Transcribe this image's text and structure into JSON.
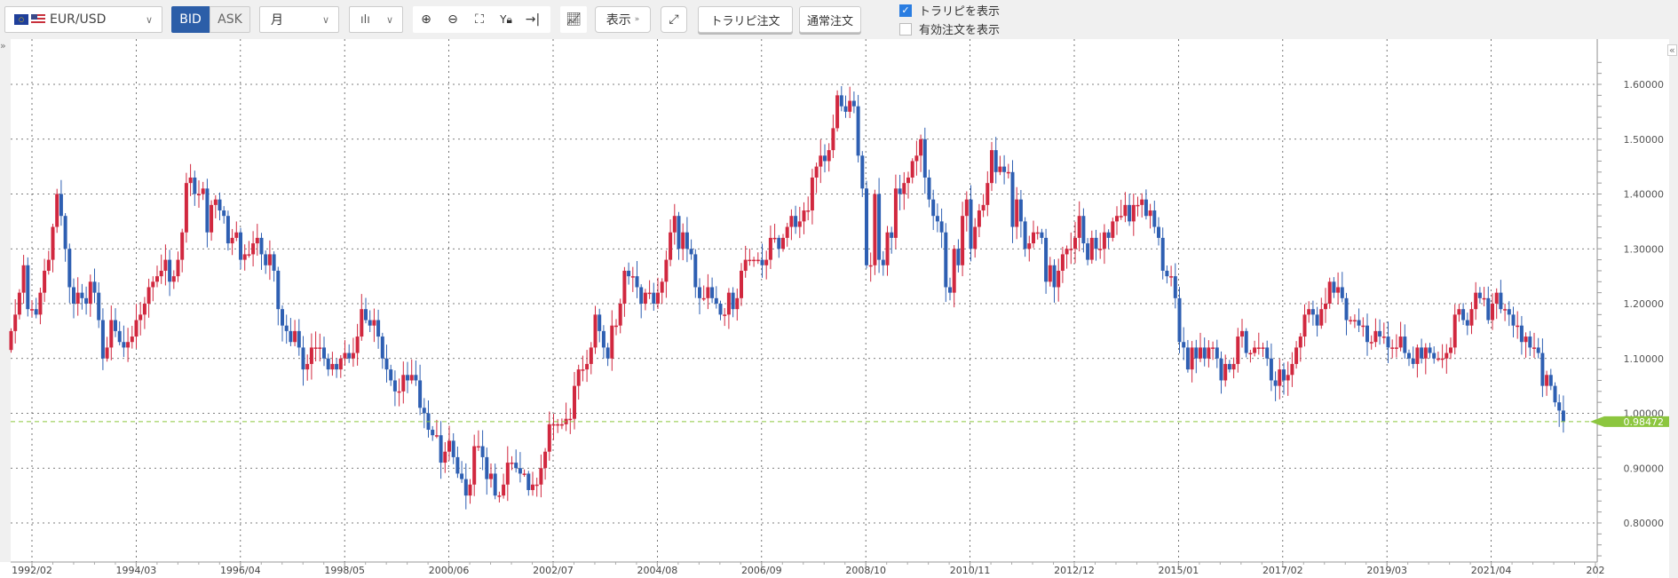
{
  "toolbar": {
    "pair": "EUR/USD",
    "bid": "BID",
    "ask": "ASK",
    "timeframe": "月",
    "display": "表示",
    "trarip_order": "トラリピ注文",
    "normal_order": "通常注文",
    "show_trarip": "トラリピを表示",
    "show_trarip_checked": true,
    "show_active_orders": "有効注文を表示",
    "show_active_orders_checked": false,
    "icons": [
      "zoom-in-icon",
      "zoom-out-icon",
      "fit-icon",
      "y-lock-icon",
      "jump-latest-icon",
      "indicator-icon",
      "expand-icon"
    ]
  },
  "colors": {
    "up": "#d1283f",
    "down": "#2e5fb2",
    "current": "#8cc63f",
    "bid_active": "#2c5ea8"
  },
  "chart_data": {
    "type": "candlestick",
    "start": "1991/09",
    "interval": "month",
    "ylim": [
      0.74,
      1.66
    ],
    "yticks": [
      "0.80000",
      "0.90000",
      "1.00000",
      "1.10000",
      "1.20000",
      "1.30000",
      "1.40000",
      "1.50000",
      "1.60000"
    ],
    "xticks": [
      "1992/02",
      "1994/03",
      "1996/04",
      "1998/05",
      "2000/06",
      "2002/07",
      "2004/08",
      "2006/09",
      "2008/10",
      "2010/11",
      "2012/12",
      "2015/01",
      "2017/02",
      "2019/03",
      "2021/04",
      "202"
    ],
    "current_price": 0.98472,
    "current_label": "0.98472",
    "close": [
      1.15,
      1.18,
      1.22,
      1.27,
      1.19,
      1.19,
      1.18,
      1.22,
      1.26,
      1.28,
      1.34,
      1.4,
      1.36,
      1.3,
      1.23,
      1.2,
      1.22,
      1.21,
      1.2,
      1.24,
      1.22,
      1.17,
      1.1,
      1.12,
      1.17,
      1.15,
      1.13,
      1.12,
      1.13,
      1.14,
      1.17,
      1.18,
      1.2,
      1.23,
      1.24,
      1.25,
      1.26,
      1.28,
      1.24,
      1.25,
      1.28,
      1.33,
      1.42,
      1.43,
      1.4,
      1.4,
      1.41,
      1.33,
      1.38,
      1.39,
      1.37,
      1.36,
      1.31,
      1.32,
      1.33,
      1.28,
      1.29,
      1.29,
      1.31,
      1.32,
      1.29,
      1.27,
      1.29,
      1.26,
      1.19,
      1.16,
      1.15,
      1.13,
      1.15,
      1.12,
      1.08,
      1.09,
      1.12,
      1.12,
      1.12,
      1.1,
      1.08,
      1.09,
      1.08,
      1.1,
      1.11,
      1.1,
      1.11,
      1.14,
      1.19,
      1.17,
      1.16,
      1.17,
      1.14,
      1.1,
      1.08,
      1.06,
      1.04,
      1.04,
      1.07,
      1.06,
      1.07,
      1.06,
      1.01,
      1.0,
      0.97,
      0.96,
      0.96,
      0.91,
      0.93,
      0.95,
      0.92,
      0.89,
      0.88,
      0.85,
      0.87,
      0.94,
      0.94,
      0.92,
      0.88,
      0.89,
      0.85,
      0.85,
      0.87,
      0.91,
      0.91,
      0.9,
      0.89,
      0.89,
      0.86,
      0.87,
      0.87,
      0.9,
      0.93,
      0.98,
      0.98,
      0.98,
      0.98,
      0.99,
      0.99,
      1.05,
      1.08,
      1.08,
      1.09,
      1.12,
      1.18,
      1.15,
      1.12,
      1.1,
      1.16,
      1.16,
      1.2,
      1.26,
      1.25,
      1.25,
      1.23,
      1.2,
      1.22,
      1.22,
      1.2,
      1.22,
      1.24,
      1.28,
      1.33,
      1.36,
      1.3,
      1.33,
      1.3,
      1.29,
      1.23,
      1.21,
      1.21,
      1.23,
      1.21,
      1.2,
      1.18,
      1.18,
      1.22,
      1.19,
      1.21,
      1.26,
      1.28,
      1.28,
      1.28,
      1.28,
      1.27,
      1.28,
      1.32,
      1.32,
      1.3,
      1.32,
      1.34,
      1.36,
      1.34,
      1.35,
      1.37,
      1.37,
      1.43,
      1.45,
      1.47,
      1.46,
      1.48,
      1.52,
      1.58,
      1.56,
      1.55,
      1.57,
      1.56,
      1.47,
      1.41,
      1.27,
      1.27,
      1.4,
      1.28,
      1.27,
      1.33,
      1.32,
      1.41,
      1.4,
      1.42,
      1.43,
      1.46,
      1.47,
      1.5,
      1.43,
      1.39,
      1.36,
      1.35,
      1.33,
      1.23,
      1.22,
      1.3,
      1.27,
      1.36,
      1.39,
      1.3,
      1.34,
      1.37,
      1.38,
      1.42,
      1.48,
      1.44,
      1.45,
      1.44,
      1.44,
      1.34,
      1.39,
      1.35,
      1.3,
      1.31,
      1.33,
      1.33,
      1.32,
      1.24,
      1.27,
      1.23,
      1.26,
      1.29,
      1.3,
      1.3,
      1.32,
      1.36,
      1.31,
      1.28,
      1.32,
      1.3,
      1.3,
      1.33,
      1.32,
      1.35,
      1.36,
      1.36,
      1.38,
      1.35,
      1.38,
      1.38,
      1.39,
      1.36,
      1.37,
      1.34,
      1.32,
      1.26,
      1.25,
      1.25,
      1.21,
      1.13,
      1.12,
      1.08,
      1.12,
      1.1,
      1.12,
      1.1,
      1.12,
      1.12,
      1.1,
      1.06,
      1.09,
      1.08,
      1.09,
      1.14,
      1.15,
      1.11,
      1.11,
      1.12,
      1.12,
      1.12,
      1.1,
      1.06,
      1.05,
      1.08,
      1.06,
      1.07,
      1.09,
      1.12,
      1.14,
      1.18,
      1.19,
      1.18,
      1.16,
      1.19,
      1.2,
      1.24,
      1.22,
      1.23,
      1.21,
      1.17,
      1.17,
      1.17,
      1.16,
      1.16,
      1.13,
      1.13,
      1.15,
      1.14,
      1.14,
      1.12,
      1.12,
      1.12,
      1.14,
      1.11,
      1.1,
      1.09,
      1.12,
      1.1,
      1.12,
      1.11,
      1.1,
      1.1,
      1.1,
      1.11,
      1.12,
      1.18,
      1.19,
      1.17,
      1.16,
      1.19,
      1.22,
      1.21,
      1.21,
      1.17,
      1.2,
      1.22,
      1.19,
      1.19,
      1.18,
      1.16,
      1.16,
      1.13,
      1.14,
      1.12,
      1.12,
      1.11,
      1.05,
      1.07,
      1.05,
      1.02,
      1.005,
      0.98472
    ]
  }
}
